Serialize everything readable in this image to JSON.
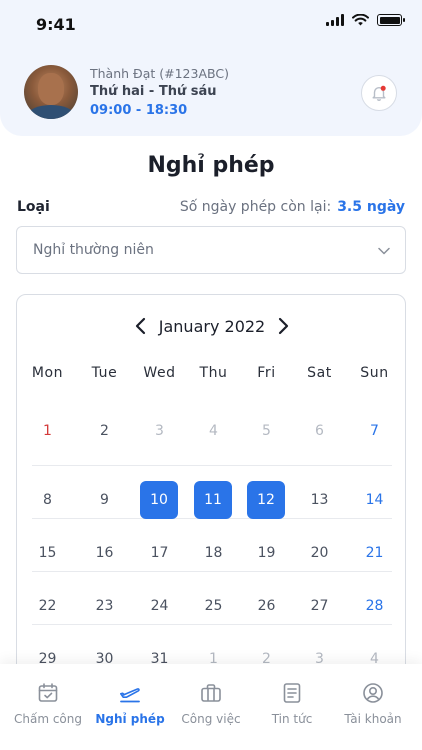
{
  "status": {
    "time": "9:41"
  },
  "user": {
    "name": "Thành Đạt (#123ABC)",
    "workdays": "Thứ hai - Thứ sáu",
    "hours": "09:00 - 18:30"
  },
  "page": {
    "title": "Nghỉ phép"
  },
  "form": {
    "type_label": "Loại",
    "remaining_label": "Số ngày phép còn lại:",
    "remaining_value": "3.5 ngày",
    "leave_type": "Nghỉ thường niên"
  },
  "calendar": {
    "month_label": "January 2022",
    "weekdays": [
      "Mon",
      "Tue",
      "Wed",
      "Thu",
      "Fri",
      "Sat",
      "Sun"
    ],
    "rows": [
      [
        "1",
        "2",
        "3",
        "4",
        "5",
        "6",
        "7"
      ],
      [
        "8",
        "9",
        "10",
        "11",
        "12",
        "13",
        "14"
      ],
      [
        "15",
        "16",
        "17",
        "18",
        "19",
        "20",
        "21"
      ],
      [
        "22",
        "23",
        "24",
        "25",
        "26",
        "27",
        "28"
      ],
      [
        "29",
        "30",
        "31",
        "1",
        "2",
        "3",
        "4"
      ]
    ],
    "selected_days": [
      "10",
      "11",
      "12"
    ]
  },
  "tabs": [
    {
      "label": "Chấm công",
      "icon": "calendar-check-icon",
      "active": false
    },
    {
      "label": "Nghỉ phép",
      "icon": "plane-icon",
      "active": true
    },
    {
      "label": "Công việc",
      "icon": "briefcase-icon",
      "active": false
    },
    {
      "label": "Tin tức",
      "icon": "news-icon",
      "active": false
    },
    {
      "label": "Tài khoản",
      "icon": "account-icon",
      "active": false
    }
  ],
  "colors": {
    "accent": "#2a74e8",
    "header_bg": "#f1f5fd",
    "holiday": "#d33a3a"
  }
}
